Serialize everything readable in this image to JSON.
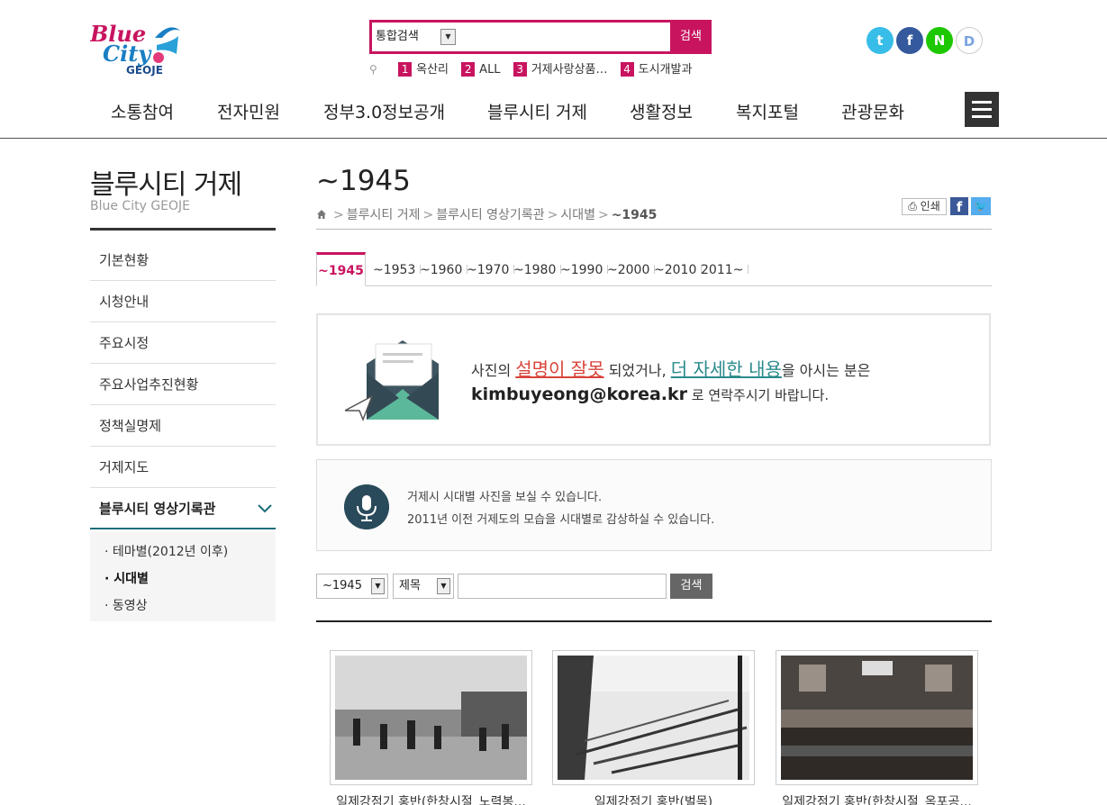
{
  "logo": {
    "line1": "Blue",
    "line2": "City",
    "line3": "GEOJE"
  },
  "search": {
    "select_label": "통합검색",
    "placeholder": "",
    "button": "검색"
  },
  "popular": [
    {
      "num": "1",
      "label": "옥산리"
    },
    {
      "num": "2",
      "label": "ALL"
    },
    {
      "num": "3",
      "label": "거제사랑상품…"
    },
    {
      "num": "4",
      "label": "도시개발과"
    }
  ],
  "social": {
    "twitter": "t",
    "facebook": "f",
    "naver": "N",
    "daum": "D"
  },
  "gnb": [
    "소통참여",
    "전자민원",
    "정부3.0정보공개",
    "블루시티 거제",
    "생활정보",
    "복지포털",
    "관광문화"
  ],
  "lnb": {
    "title": "블루시티 거제",
    "subtitle": "Blue City GEOJE",
    "items": [
      "기본현황",
      "시청안내",
      "주요시정",
      "주요사업추진현황",
      "정책실명제",
      "거제지도",
      "블루시티 영상기록관"
    ],
    "sub_items": [
      "· 테마별(2012년 이후)",
      "· 시대별",
      "· 동영상"
    ]
  },
  "page": {
    "title": "~1945",
    "breadcrumb": [
      "블루시티 거제",
      "블루시티 영상기록관",
      "시대별",
      "~1945"
    ],
    "print": "인쇄"
  },
  "tabs": [
    "~1945",
    "~1953",
    "~1960",
    "~1970",
    "~1980",
    "~1990",
    "~2000",
    "~2010",
    "2011~"
  ],
  "notice": {
    "p1": "사진의 ",
    "red": "설명이 잘못",
    "p2": " 되었거나, ",
    "teal": "더 자세한 내용",
    "p3": "을 아시는 분은",
    "email": "kimbuyeong@korea.kr",
    "p4": " 로 연락주시기 바랍니다."
  },
  "info": {
    "line1": "거제시 시대별 사진을 보실 수 있습니다.",
    "line2": "2011년 이전 거제도의 모습을 시대별로 감상하실 수 있습니다."
  },
  "filter": {
    "period": "~1945",
    "field": "제목",
    "button": "검색"
  },
  "gallery": [
    {
      "caption": "일제강점기 홍반(한창시절_노력봉..."
    },
    {
      "caption": "일제강점기 홍반(벌목)"
    },
    {
      "caption": "일제강점기 홍반(한창시절_옥포공..."
    }
  ]
}
